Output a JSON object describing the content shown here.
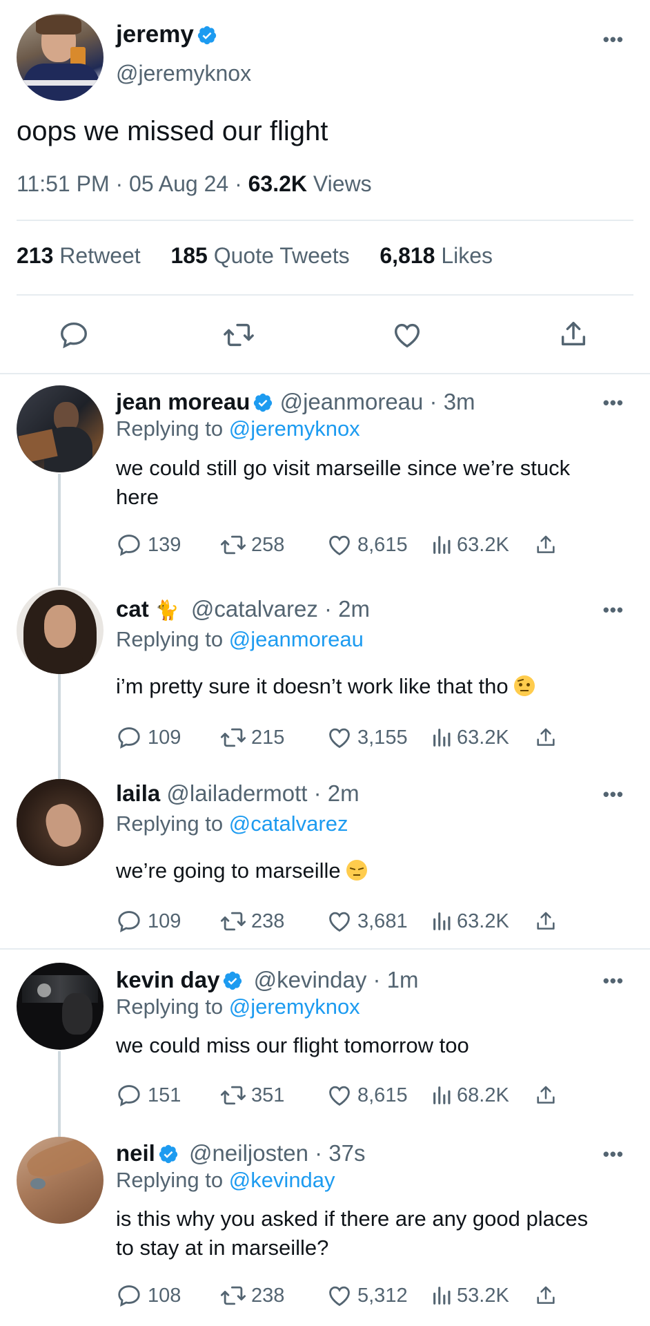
{
  "main_tweet": {
    "display_name": "jeremy",
    "handle": "@jeremyknox",
    "text": "oops we missed our flight",
    "time": "11:51 PM",
    "date": "05 Aug 24",
    "views_count": "63.2K",
    "views_label": "Views",
    "retweets_count": "213",
    "retweets_label": "Retweet",
    "quotes_count": "185",
    "quotes_label": "Quote Tweets",
    "likes_count": "6,818",
    "likes_label": "Likes"
  },
  "replies": [
    {
      "display_name": "jean moreau",
      "verified": true,
      "handle": "@jeanmoreau",
      "age": "3m",
      "replying_label": "Replying to",
      "replying_to": "@jeremyknox",
      "text": "we could still go visit marseille since we’re stuck here",
      "comments": "139",
      "retweets": "258",
      "likes": "8,615",
      "views": "63.2K"
    },
    {
      "display_name": "cat",
      "name_emoji": "🐈‍⬛",
      "handle": "@catalvarez",
      "age": "2m",
      "replying_label": "Replying to",
      "replying_to": "@jeanmoreau",
      "text": "i’m pretty sure it doesn’t work like that tho",
      "text_emoji": "raised-eyebrow-face",
      "comments": "109",
      "retweets": "215",
      "likes": "3,155",
      "views": "63.2K"
    },
    {
      "display_name": "laila",
      "handle": "@lailadermott",
      "age": "2m",
      "replying_label": "Replying to",
      "replying_to": "@catalvarez",
      "text": "we’re going to marseille",
      "text_emoji": "pensive-face",
      "comments": "109",
      "retweets": "238",
      "likes": "3,681",
      "views": "63.2K"
    },
    {
      "display_name": "kevin day",
      "verified": true,
      "handle": "@kevinday",
      "age": "1m",
      "replying_label": "Replying to",
      "replying_to": "@jeremyknox",
      "text": "we could miss our flight tomorrow too",
      "comments": "151",
      "retweets": "351",
      "likes": "8,615",
      "views": "68.2K"
    },
    {
      "display_name": "neil",
      "verified": true,
      "handle": "@neiljosten",
      "age": "37s",
      "replying_label": "Replying to",
      "replying_to": "@kevinday",
      "text": "is this why you asked if there are any good places to stay at in marseille?",
      "comments": "108",
      "retweets": "238",
      "likes": "5,312",
      "views": "53.2K"
    }
  ],
  "colors": {
    "accent": "#1d9bf0",
    "muted": "#536471",
    "text": "#0f1419",
    "divider": "#e6ecf0"
  }
}
